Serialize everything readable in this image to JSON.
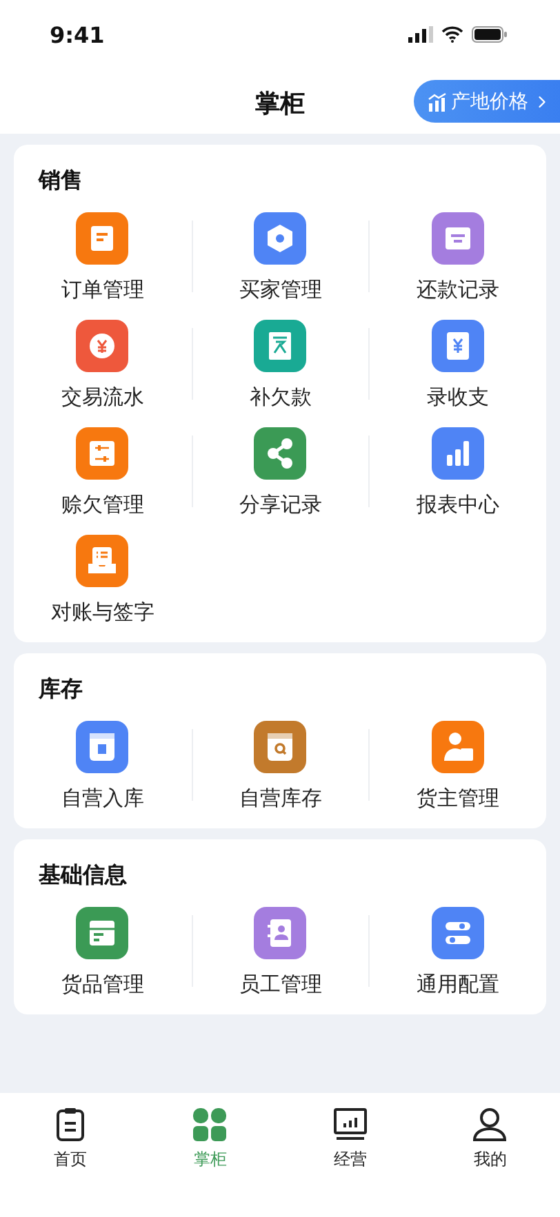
{
  "status_bar": {
    "time": "9:41"
  },
  "header": {
    "title": "掌柜",
    "price_button": {
      "label": "产地价格"
    }
  },
  "sections": [
    {
      "title": "销售",
      "items": [
        {
          "label": "订单管理",
          "color": "#f7780f"
        },
        {
          "label": "买家管理",
          "color": "#4f84f5"
        },
        {
          "label": "还款记录",
          "color": "#a47ddf"
        },
        {
          "label": "交易流水",
          "color": "#ee583c"
        },
        {
          "label": "补欠款",
          "color": "#19aa94"
        },
        {
          "label": "录收支",
          "color": "#4f84f5"
        },
        {
          "label": "赊欠管理",
          "color": "#f7780f"
        },
        {
          "label": "分享记录",
          "color": "#3b9a55"
        },
        {
          "label": "报表中心",
          "color": "#4f84f5"
        },
        {
          "label": "对账与签字",
          "color": "#f7780f"
        }
      ]
    },
    {
      "title": "库存",
      "items": [
        {
          "label": "自营入库",
          "color": "#4f84f5"
        },
        {
          "label": "自营库存",
          "color": "#c27a2c"
        },
        {
          "label": "货主管理",
          "color": "#f7780f"
        }
      ]
    },
    {
      "title": "基础信息",
      "items": [
        {
          "label": "货品管理",
          "color": "#3b9a55"
        },
        {
          "label": "员工管理",
          "color": "#a47ddf"
        },
        {
          "label": "通用配置",
          "color": "#4f84f5"
        }
      ]
    }
  ],
  "tabs": [
    {
      "label": "首页",
      "selected": false
    },
    {
      "label": "掌柜",
      "selected": true
    },
    {
      "label": "经营",
      "selected": false
    },
    {
      "label": "我的",
      "selected": false
    }
  ]
}
